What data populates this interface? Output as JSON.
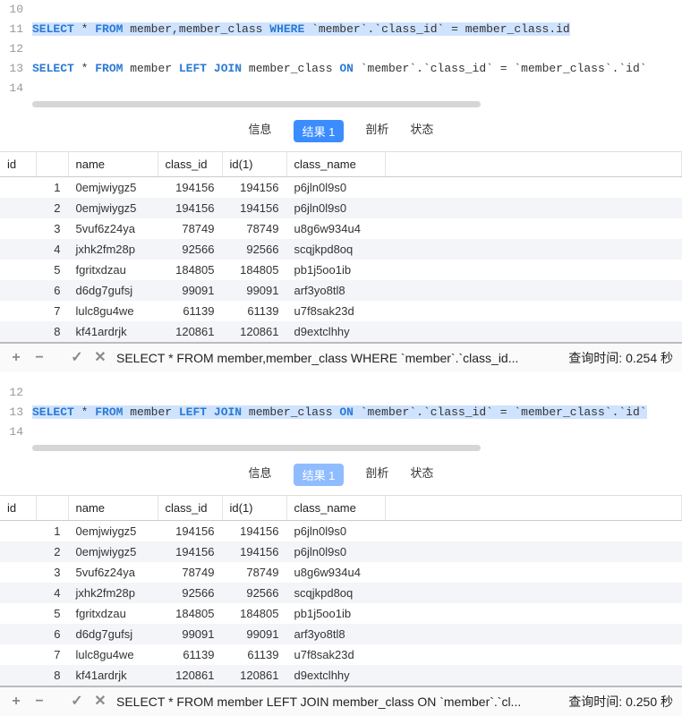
{
  "panel1": {
    "lines": [
      {
        "num": "10",
        "tokens": []
      },
      {
        "num": "11",
        "highlight": true,
        "tokens": [
          {
            "t": "SELECT",
            "k": true
          },
          {
            "t": " * "
          },
          {
            "t": "FROM",
            "k": true
          },
          {
            "t": " member,member_class "
          },
          {
            "t": "WHERE",
            "k": true
          },
          {
            "t": " `member`.`class_id` = member_class.id"
          }
        ]
      },
      {
        "num": "12",
        "tokens": []
      },
      {
        "num": "13",
        "tokens": [
          {
            "t": "SELECT",
            "k": true
          },
          {
            "t": " * "
          },
          {
            "t": "FROM",
            "k": true
          },
          {
            "t": " member "
          },
          {
            "t": "LEFT",
            "k": true
          },
          {
            "t": " "
          },
          {
            "t": "JOIN",
            "k": true
          },
          {
            "t": " member_class "
          },
          {
            "t": "ON",
            "k": true
          },
          {
            "t": " `member`.`class_id` = `member_class`.`id`"
          }
        ]
      },
      {
        "num": "14",
        "tokens": []
      }
    ],
    "tabs": {
      "info": "信息",
      "result": "结果 1",
      "profile": "剖析",
      "status": "状态"
    },
    "columns": [
      "id",
      "",
      "name",
      "class_id",
      "id(1)",
      "class_name"
    ],
    "rows": [
      {
        "idx": "1",
        "name": "0emjwiygz5",
        "class_id": "194156",
        "id1": "194156",
        "cname": "p6jln0l9s0"
      },
      {
        "idx": "2",
        "name": "0emjwiygz5",
        "class_id": "194156",
        "id1": "194156",
        "cname": "p6jln0l9s0"
      },
      {
        "idx": "3",
        "name": "5vuf6z24ya",
        "class_id": "78749",
        "id1": "78749",
        "cname": "u8g6w934u4"
      },
      {
        "idx": "4",
        "name": "jxhk2fm28p",
        "class_id": "92566",
        "id1": "92566",
        "cname": "scqjkpd8oq"
      },
      {
        "idx": "5",
        "name": "fgritxdzau",
        "class_id": "184805",
        "id1": "184805",
        "cname": "pb1j5oo1ib"
      },
      {
        "idx": "6",
        "name": "d6dg7gufsj",
        "class_id": "99091",
        "id1": "99091",
        "cname": "arf3yo8tl8"
      },
      {
        "idx": "7",
        "name": "lulc8gu4we",
        "class_id": "61139",
        "id1": "61139",
        "cname": "u7f8sak23d"
      },
      {
        "idx": "8",
        "name": "kf41ardrjk",
        "class_id": "120861",
        "id1": "120861",
        "cname": "d9extclhhy"
      }
    ],
    "status_sql": "SELECT * FROM member,member_class WHERE `member`.`class_id...",
    "status_time": "查询时间: 0.254 秒"
  },
  "panel2": {
    "lines": [
      {
        "num": "12",
        "tokens": []
      },
      {
        "num": "13",
        "highlight": true,
        "tokens": [
          {
            "t": "SELECT",
            "k": true
          },
          {
            "t": " * "
          },
          {
            "t": "FROM",
            "k": true
          },
          {
            "t": " member "
          },
          {
            "t": "LEFT",
            "k": true
          },
          {
            "t": " "
          },
          {
            "t": "JOIN",
            "k": true
          },
          {
            "t": " member_class "
          },
          {
            "t": "ON",
            "k": true
          },
          {
            "t": " `member`.`class_id` = `member_class`.`id`"
          }
        ]
      },
      {
        "num": "14",
        "tokens": []
      }
    ],
    "tabs": {
      "info": "信息",
      "result": "结果 1",
      "profile": "剖析",
      "status": "状态"
    },
    "columns": [
      "id",
      "",
      "name",
      "class_id",
      "id(1)",
      "class_name"
    ],
    "rows": [
      {
        "idx": "1",
        "name": "0emjwiygz5",
        "class_id": "194156",
        "id1": "194156",
        "cname": "p6jln0l9s0"
      },
      {
        "idx": "2",
        "name": "0emjwiygz5",
        "class_id": "194156",
        "id1": "194156",
        "cname": "p6jln0l9s0"
      },
      {
        "idx": "3",
        "name": "5vuf6z24ya",
        "class_id": "78749",
        "id1": "78749",
        "cname": "u8g6w934u4"
      },
      {
        "idx": "4",
        "name": "jxhk2fm28p",
        "class_id": "92566",
        "id1": "92566",
        "cname": "scqjkpd8oq"
      },
      {
        "idx": "5",
        "name": "fgritxdzau",
        "class_id": "184805",
        "id1": "184805",
        "cname": "pb1j5oo1ib"
      },
      {
        "idx": "6",
        "name": "d6dg7gufsj",
        "class_id": "99091",
        "id1": "99091",
        "cname": "arf3yo8tl8"
      },
      {
        "idx": "7",
        "name": "lulc8gu4we",
        "class_id": "61139",
        "id1": "61139",
        "cname": "u7f8sak23d"
      },
      {
        "idx": "8",
        "name": "kf41ardrjk",
        "class_id": "120861",
        "id1": "120861",
        "cname": "d9extclhhy"
      }
    ],
    "status_sql": "SELECT * FROM member LEFT JOIN member_class ON `member`.`cl...",
    "status_time": "查询时间: 0.250 秒"
  },
  "icons": {
    "plus": "+",
    "minus": "−",
    "check": "✓",
    "close": "✕"
  }
}
